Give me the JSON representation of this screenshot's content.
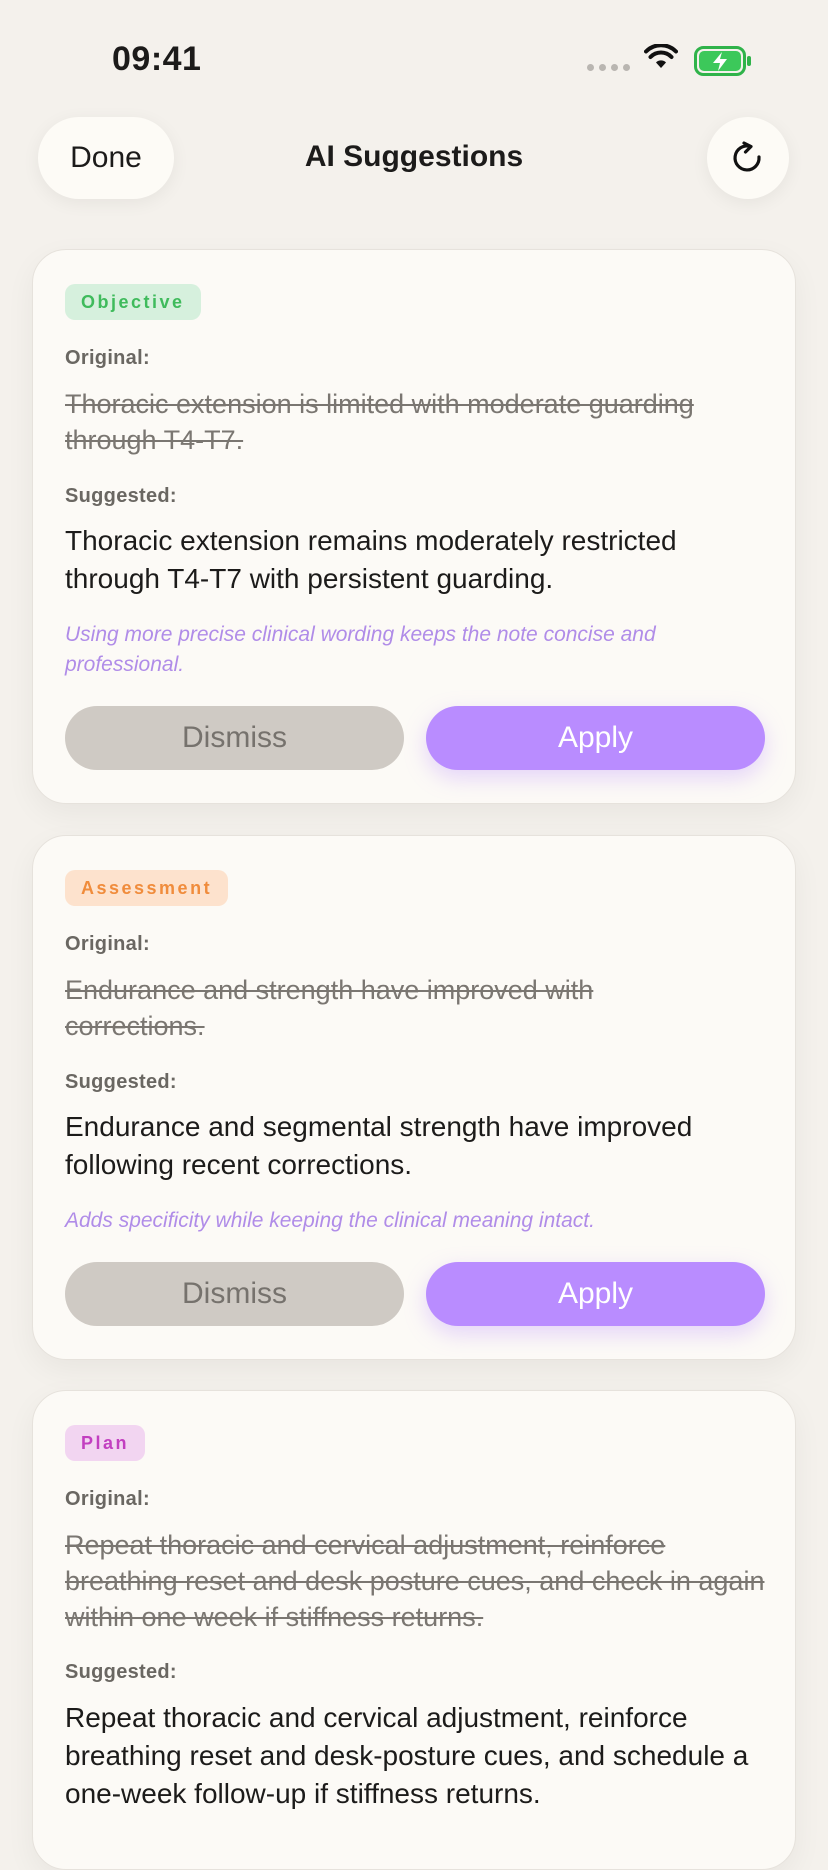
{
  "status": {
    "time": "09:41"
  },
  "nav": {
    "done_label": "Done",
    "title": "AI Suggestions"
  },
  "colors": {
    "accent": "#b98cff",
    "objective_bg": "#d6f0dd",
    "objective_fg": "#3fbb5c",
    "assessment_bg": "#fde2cd",
    "assessment_fg": "#f08c3c",
    "plan_bg": "#f2d5f1",
    "plan_fg": "#c23fc0"
  },
  "suggestions": [
    {
      "section": "Objective",
      "original_label": "Original:",
      "original": "Thoracic extension is limited with moderate guarding through T4-T7.",
      "suggested_label": "Suggested:",
      "suggested": "Thoracic extension remains moderately restricted through T4-T7 with persistent guarding.",
      "reason": "Using more precise clinical wording keeps the note concise and professional.",
      "dismiss_label": "Dismiss",
      "apply_label": "Apply"
    },
    {
      "section": "Assessment",
      "original_label": "Original:",
      "original": "Endurance and strength have improved with corrections.",
      "suggested_label": "Suggested:",
      "suggested": "Endurance and segmental strength have improved following recent corrections.",
      "reason": "Adds specificity while keeping the clinical meaning intact.",
      "dismiss_label": "Dismiss",
      "apply_label": "Apply"
    },
    {
      "section": "Plan",
      "original_label": "Original:",
      "original": "Repeat thoracic and cervical adjustment, reinforce breathing reset and desk posture cues, and check in again within one week if stiffness returns.",
      "suggested_label": "Suggested:",
      "suggested": "Repeat thoracic and cervical adjustment, reinforce breathing reset and desk-posture cues, and schedule a one-week follow-up if stiffness returns."
    }
  ]
}
